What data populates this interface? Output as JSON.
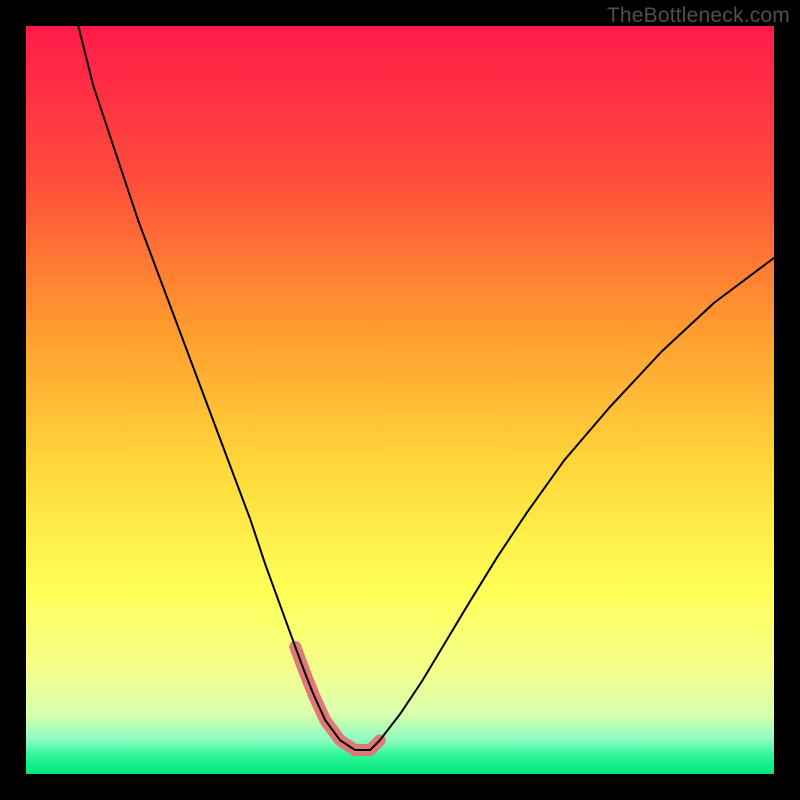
{
  "watermark": {
    "text": "TheBottleneck.com"
  },
  "chart_data": {
    "type": "line",
    "title": "",
    "xlabel": "",
    "ylabel": "",
    "xlim": [
      0,
      100
    ],
    "ylim": [
      0,
      100
    ],
    "grid": false,
    "legend": false,
    "background": {
      "type": "vertical-gradient",
      "stops": [
        {
          "pos": 0.0,
          "color": "#ff1b4a"
        },
        {
          "pos": 0.2,
          "color": "#ff4b3b"
        },
        {
          "pos": 0.4,
          "color": "#ff9a2f"
        },
        {
          "pos": 0.58,
          "color": "#ffd53a"
        },
        {
          "pos": 0.75,
          "color": "#ffff55"
        },
        {
          "pos": 0.86,
          "color": "#f4ff8a"
        },
        {
          "pos": 0.92,
          "color": "#d8ffad"
        },
        {
          "pos": 0.955,
          "color": "#8cfcc0"
        },
        {
          "pos": 0.975,
          "color": "#2ef59a"
        },
        {
          "pos": 1.0,
          "color": "#00e77a"
        }
      ]
    },
    "series": [
      {
        "name": "bottleneck-curve",
        "color": "#000000",
        "width": 2,
        "x": [
          7,
          9,
          12,
          15,
          18,
          21,
          24,
          27,
          30,
          32,
          34,
          36,
          37.3,
          38.5,
          40,
          42,
          44,
          46,
          47.3,
          50,
          53,
          56,
          59,
          63,
          67,
          72,
          78,
          85,
          92,
          100
        ],
        "y": [
          100,
          92,
          83,
          74,
          66,
          58,
          50,
          42,
          34,
          28,
          22.5,
          17,
          13.5,
          10.5,
          7.2,
          4.5,
          3.2,
          3.2,
          4.5,
          8,
          12.5,
          17.5,
          22.5,
          29,
          35,
          42,
          49,
          56.5,
          63,
          69
        ]
      }
    ],
    "highlight": {
      "name": "valley-highlight",
      "color": "#e07878",
      "width": 12,
      "linecap": "round",
      "x": [
        36,
        37.3,
        38.5,
        40,
        42,
        44,
        46,
        47.3
      ],
      "y": [
        17,
        13.5,
        10.5,
        7.2,
        4.5,
        3.2,
        3.2,
        4.5
      ]
    }
  }
}
